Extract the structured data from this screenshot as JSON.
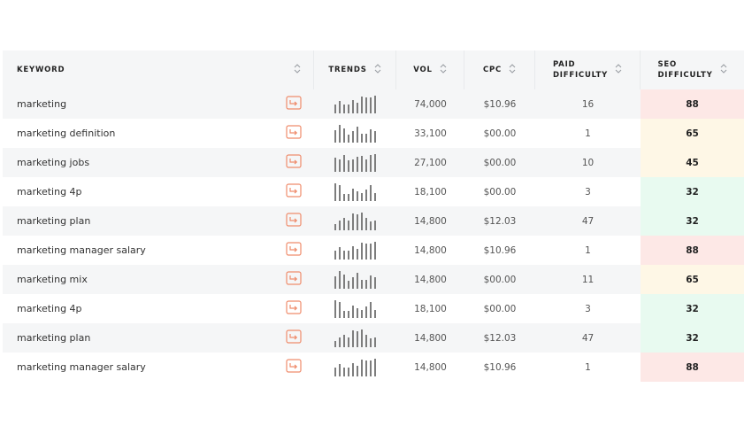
{
  "colors": {
    "accent_icon": "#ef8c6c",
    "seo_high": "#fde8e6",
    "seo_mid": "#fef7e6",
    "seo_low": "#e8faf0"
  },
  "header": {
    "keyword": "KEYWORD",
    "trends": "TRENDS",
    "vol": "VOL",
    "cpc": "CPC",
    "paid_difficulty": "PAID\nDIFFICULTY",
    "seo_difficulty": "SEO\nDIFFICULTY"
  },
  "rows": [
    {
      "keyword": "marketing",
      "vol": "74,000",
      "cpc": "$10.96",
      "paid": "16",
      "seo": "88",
      "seo_level": "high",
      "trend": [
        0.35,
        0.6,
        0.35,
        0.4,
        0.7,
        0.5,
        0.95,
        0.85,
        0.9,
        1.0
      ]
    },
    {
      "keyword": "marketing definition",
      "vol": "33,100",
      "cpc": "$00.00",
      "paid": "1",
      "seo": "65",
      "seo_level": "mid",
      "trend": [
        0.6,
        1.0,
        0.75,
        0.3,
        0.55,
        0.9,
        0.4,
        0.35,
        0.7,
        0.55
      ]
    },
    {
      "keyword": "marketing jobs",
      "vol": "27,100",
      "cpc": "$00.00",
      "paid": "10",
      "seo": "45",
      "seo_level": "mid",
      "trend": [
        0.75,
        0.6,
        0.95,
        0.55,
        0.6,
        0.8,
        0.85,
        0.6,
        0.95,
        1.0
      ]
    },
    {
      "keyword": "marketing 4p",
      "vol": "18,100",
      "cpc": "$00.00",
      "paid": "3",
      "seo": "32",
      "seo_level": "low",
      "trend": [
        1.0,
        0.85,
        0.25,
        0.25,
        0.6,
        0.45,
        0.3,
        0.55,
        0.85,
        0.3
      ]
    },
    {
      "keyword": "marketing plan",
      "vol": "14,800",
      "cpc": "$12.03",
      "paid": "47",
      "seo": "32",
      "seo_level": "low",
      "trend": [
        0.2,
        0.45,
        0.6,
        0.45,
        0.95,
        0.9,
        1.0,
        0.65,
        0.4,
        0.45
      ]
    },
    {
      "keyword": "marketing manager salary",
      "vol": "14,800",
      "cpc": "$10.96",
      "paid": "1",
      "seo": "88",
      "seo_level": "high",
      "trend": [
        0.35,
        0.6,
        0.35,
        0.4,
        0.7,
        0.5,
        0.95,
        0.85,
        0.9,
        1.0
      ]
    },
    {
      "keyword": "marketing mix",
      "vol": "14,800",
      "cpc": "$00.00",
      "paid": "11",
      "seo": "65",
      "seo_level": "mid",
      "trend": [
        0.6,
        1.0,
        0.75,
        0.3,
        0.55,
        0.9,
        0.4,
        0.35,
        0.7,
        0.55
      ]
    },
    {
      "keyword": "marketing 4p",
      "vol": "18,100",
      "cpc": "$00.00",
      "paid": "3",
      "seo": "32",
      "seo_level": "low",
      "trend": [
        1.0,
        0.85,
        0.25,
        0.25,
        0.6,
        0.45,
        0.3,
        0.55,
        0.85,
        0.3
      ]
    },
    {
      "keyword": "marketing plan",
      "vol": "14,800",
      "cpc": "$12.03",
      "paid": "47",
      "seo": "32",
      "seo_level": "low",
      "trend": [
        0.2,
        0.45,
        0.6,
        0.45,
        0.95,
        0.9,
        1.0,
        0.65,
        0.4,
        0.45
      ]
    },
    {
      "keyword": "marketing manager salary",
      "vol": "14,800",
      "cpc": "$10.96",
      "paid": "1",
      "seo": "88",
      "seo_level": "high",
      "trend": [
        0.35,
        0.6,
        0.35,
        0.4,
        0.7,
        0.5,
        0.95,
        0.85,
        0.9,
        1.0
      ]
    }
  ]
}
